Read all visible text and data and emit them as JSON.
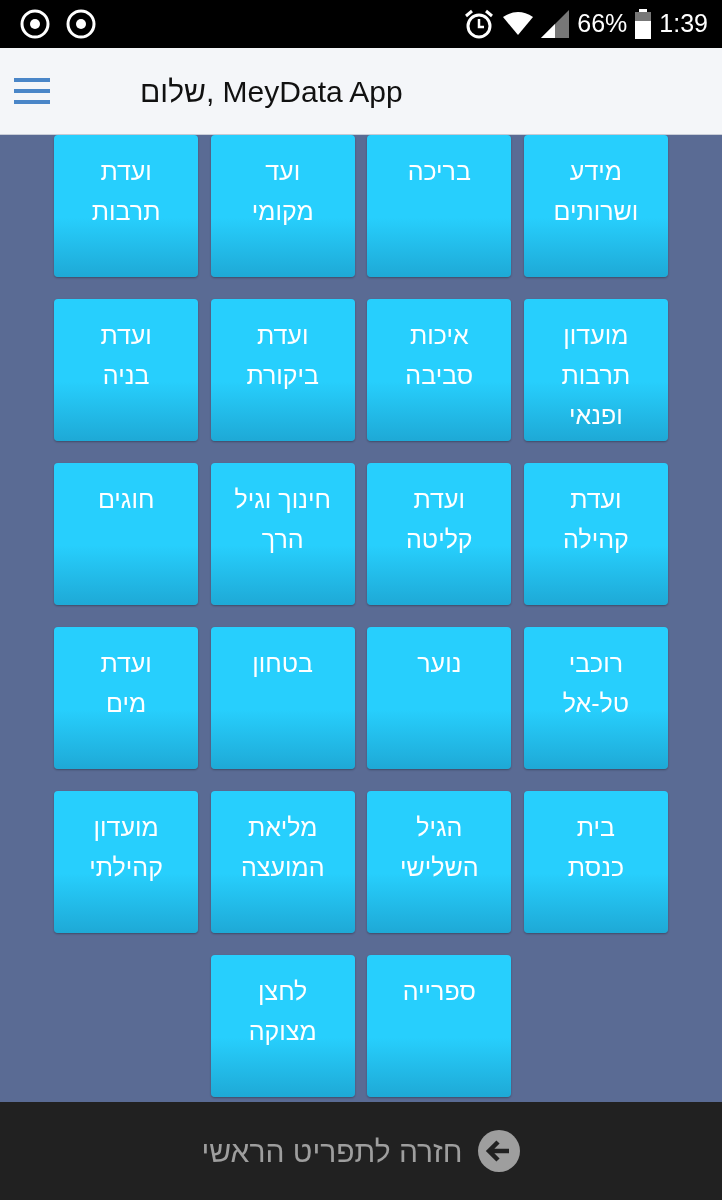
{
  "status_bar": {
    "battery": "66%",
    "time": "1:39"
  },
  "header": {
    "title": "שלום, MeyData App"
  },
  "tiles": [
    {
      "label": "מידע\nושרותים"
    },
    {
      "label": "בריכה"
    },
    {
      "label": "ועד\nמקומי"
    },
    {
      "label": "ועדת\nתרבות"
    },
    {
      "label": "מועדון\nתרבות\nופנאי"
    },
    {
      "label": "איכות\nסביבה"
    },
    {
      "label": "ועדת\nביקורת"
    },
    {
      "label": "ועדת\nבניה"
    },
    {
      "label": "ועדת\nקהילה"
    },
    {
      "label": "ועדת\nקליטה"
    },
    {
      "label": "חינוך וגיל\nהרך"
    },
    {
      "label": "חוגים"
    },
    {
      "label": "רוכבי\nטל-אל"
    },
    {
      "label": "נוער"
    },
    {
      "label": "בטחון"
    },
    {
      "label": "ועדת\nמים"
    },
    {
      "label": "בית\nכנסת"
    },
    {
      "label": "הגיל\nהשלישי"
    },
    {
      "label": "מליאת\nהמועצה"
    },
    {
      "label": "מועדון\nקהילתי"
    },
    {
      "label": "ספרייה"
    },
    {
      "label": "לחצן\nמצוקה"
    }
  ],
  "footer": {
    "label": "חזרה לתפריט הראשי"
  }
}
